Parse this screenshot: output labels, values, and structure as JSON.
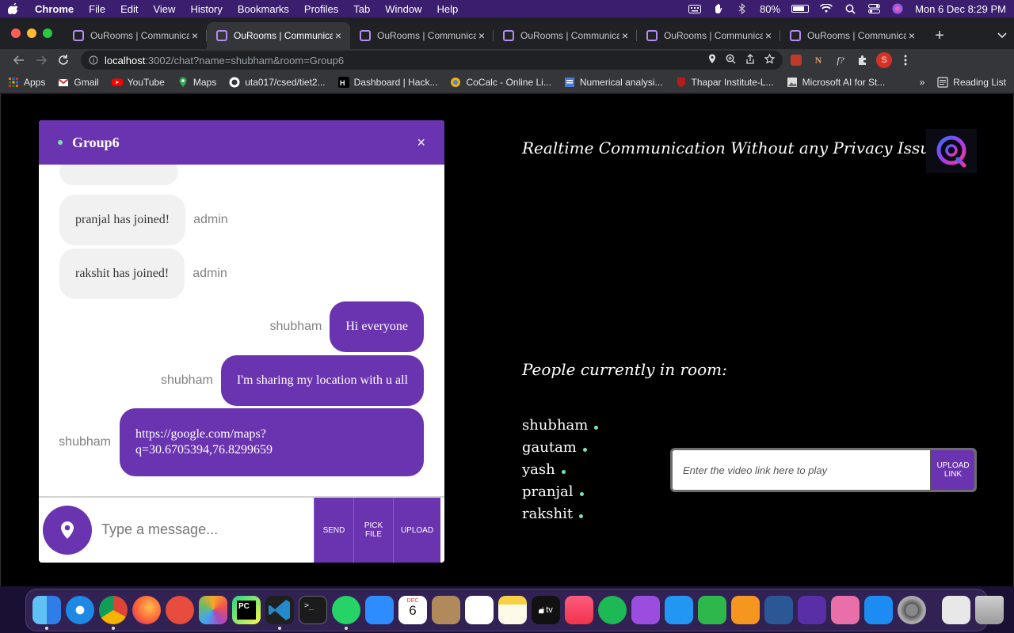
{
  "menubar": {
    "app": "Chrome",
    "menus": [
      "File",
      "Edit",
      "View",
      "History",
      "Bookmarks",
      "Profiles",
      "Tab",
      "Window",
      "Help"
    ],
    "battery": "80%",
    "datetime": "Mon 6 Dec  8:29 PM"
  },
  "browser": {
    "tabs": [
      {
        "title": "OuRooms | Communicati"
      },
      {
        "title": "OuRooms | Communicati"
      },
      {
        "title": "OuRooms | Communicati"
      },
      {
        "title": "OuRooms | Communicati"
      },
      {
        "title": "OuRooms | Communicati"
      },
      {
        "title": "OuRooms | Communicati"
      }
    ],
    "url_host": "localhost",
    "url_rest": ":3002/chat?name=shubham&room=Group6",
    "profile_initial": "S",
    "bookmarks": [
      "Apps",
      "Gmail",
      "YouTube",
      "Maps",
      "uta017/csed/tiet2...",
      "Dashboard | Hack...",
      "CoCalc - Online Li...",
      "Numerical analysi...",
      "Thapar Institute-L...",
      "Microsoft AI for St..."
    ],
    "reading_list": "Reading List",
    "overflow": "»"
  },
  "chat": {
    "room": "Group6",
    "close": "×",
    "messages": [
      {
        "text": "pranjal has joined!",
        "sender": "admin",
        "mine": false
      },
      {
        "text": "rakshit has joined!",
        "sender": "admin",
        "mine": false
      },
      {
        "text": "Hi everyone",
        "sender": "shubham",
        "mine": true
      },
      {
        "text": "I'm sharing my location with u all",
        "sender": "shubham",
        "mine": true
      },
      {
        "text_line1": "https://google.com/maps?",
        "text_line2": "q=30.6705394,76.8299659",
        "sender": "shubham",
        "mine": true
      }
    ],
    "input_placeholder": "Type a message...",
    "send": "SEND",
    "pick_file_1": "PICK",
    "pick_file_2": "FILE",
    "upload": "UPLOAD"
  },
  "sidebar": {
    "tagline": "Realtime Communication Without any Privacy Issues",
    "people_title": "People currently in room:",
    "people": [
      "shubham",
      "gautam",
      "yash",
      "pranjal",
      "rakshit"
    ],
    "video_placeholder": "Enter the video link here to play",
    "upload_link_1": "UPLOAD",
    "upload_link_2": "LINK"
  },
  "dock": {
    "calendar_month": "DEC",
    "calendar_day": "6",
    "tv_label": "tv"
  },
  "colors": {
    "accent": "#6a33b0",
    "online": "#7ae3b1",
    "bubble_in": "#f1f1f1"
  }
}
